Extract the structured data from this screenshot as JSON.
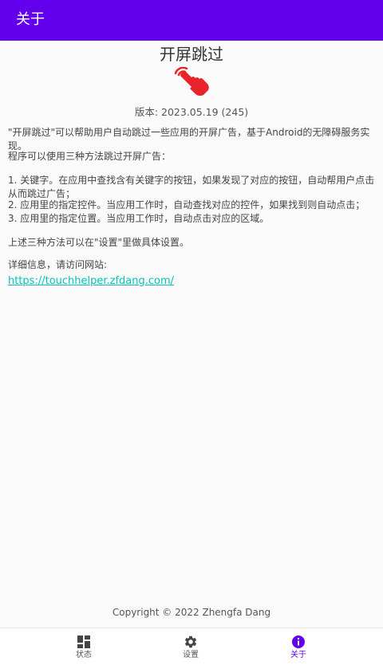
{
  "appbar": {
    "title": "关于"
  },
  "about": {
    "app_name": "开屏跳过",
    "version": "版本: 2023.05.19 (245)",
    "description": "\"开屏跳过\"可以帮助用户自动跳过一些应用的开屏广告，基于Android的无障碍服务实现。",
    "methods_intro": "程序可以使用三种方法跳过开屏广告：",
    "methods": [
      "1. 关键字。在应用中查找含有关键字的按钮，如果发现了对应的按钮，自动帮用户点击从而跳过广告；",
      "2. 应用里的指定控件。当应用工作时，自动查找对应的控件，如果找到则自动点击；",
      "3. 应用里的指定位置。当应用工作时，自动点击对应的区域。"
    ],
    "settings_note": "上述三种方法可以在\"设置\"里做具体设置。",
    "website_label": "详细信息，请访问网站:",
    "website_url": "https://touchhelper.zfdang.com/",
    "copyright": "Copyright © 2022 Zhengfa Dang"
  },
  "bottom_nav": {
    "items": [
      {
        "label": "状态",
        "icon": "dashboard-icon",
        "active": false
      },
      {
        "label": "设置",
        "icon": "gear-icon",
        "active": false
      },
      {
        "label": "关于",
        "icon": "info-icon",
        "active": true
      }
    ]
  },
  "colors": {
    "primary": "#6200ee",
    "link": "#03c4b6",
    "hand_icon": "#e8242a"
  }
}
